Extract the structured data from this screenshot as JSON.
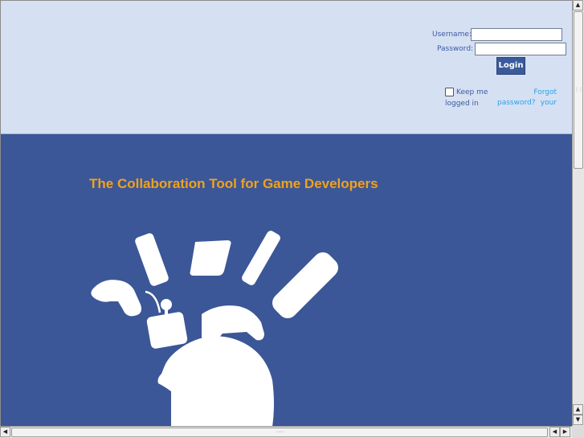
{
  "login": {
    "username_label": "Username:",
    "password_label": "Password:",
    "username_value": "",
    "password_value": "",
    "login_button": "Login",
    "keep_logged_in_line1": "Keep me",
    "keep_logged_in_line2": "logged in",
    "forgot_line1": "Forgot your",
    "forgot_line2": "password?",
    "keep_logged_in_checked": false
  },
  "hero": {
    "tagline": "The Collaboration Tool for Game Developers",
    "artwork": "game-controllers-head-icon"
  },
  "colors": {
    "header_bg": "#d5e0f3",
    "hero_bg": "#3c5797",
    "tagline": "#f0a21c",
    "link": "#2aa2e6",
    "button": "#3b5a9a"
  }
}
